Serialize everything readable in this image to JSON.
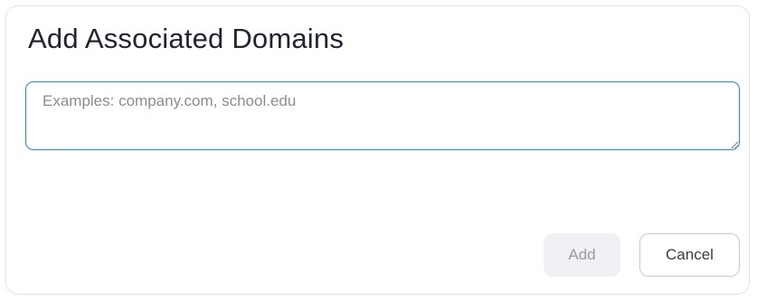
{
  "dialog": {
    "title": "Add Associated Domains",
    "domains_input": {
      "value": "",
      "placeholder": "Examples: company.com, school.edu"
    },
    "buttons": {
      "add_label": "Add",
      "add_enabled": false,
      "cancel_label": "Cancel"
    }
  },
  "colors": {
    "focus_border": "#2d8cff",
    "title_text": "#232333",
    "disabled_button_bg": "#f0f0f5"
  }
}
